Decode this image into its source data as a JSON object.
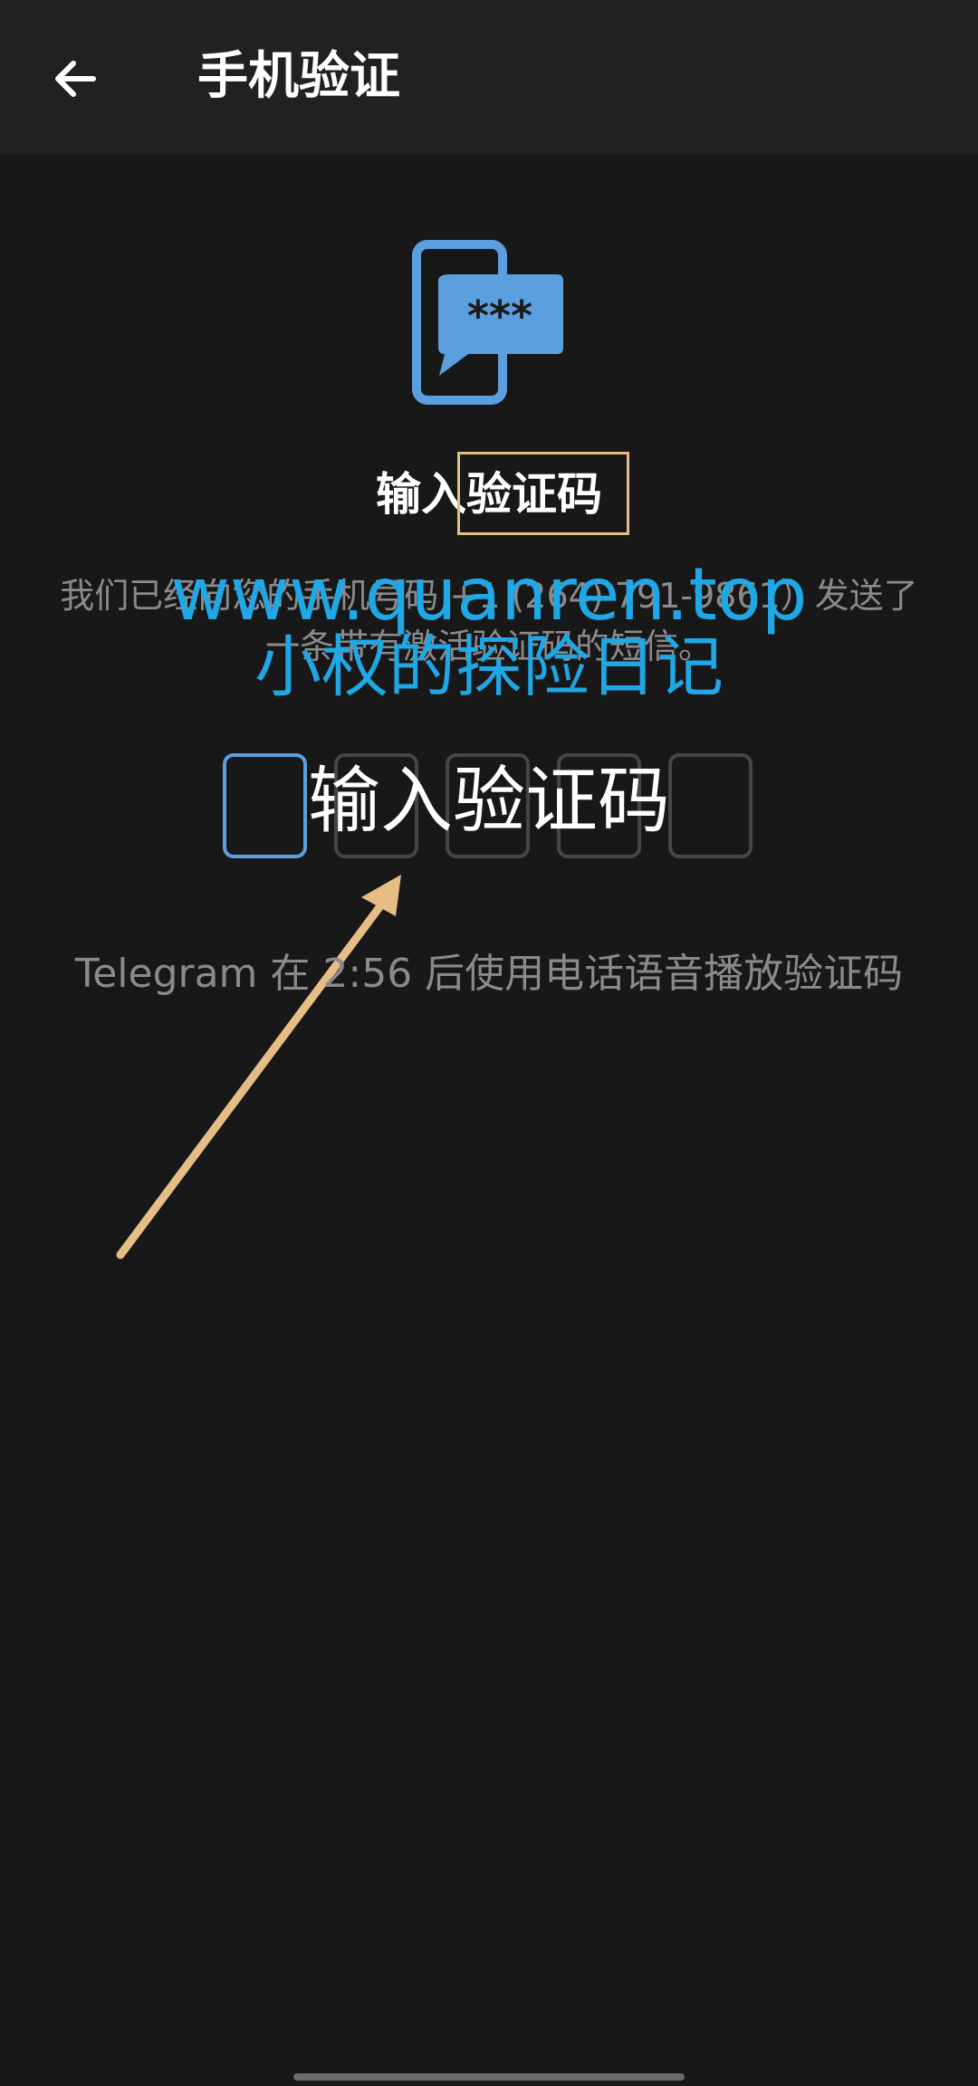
{
  "appbar": {
    "back_icon": "arrow-left-icon",
    "title": "手机验证"
  },
  "hero": {
    "icon": "sms-code-phone-icon",
    "icon_text": "***",
    "heading": "输入验证码"
  },
  "description": "我们已经向您的手机号码 +1 (264) 791-9861）发送了一条带有激活验证码的短信。",
  "watermark": {
    "url": "www.quanren.top",
    "subtitle": "小权的探险日记"
  },
  "code_input": {
    "cells": [
      "",
      "",
      "",
      "",
      ""
    ],
    "overlay_label": "输入验证码"
  },
  "voice_hint": "Telegram 在 2:56 后使用电话语音播放验证码",
  "colors": {
    "background": "#181818",
    "appbar": "#212121",
    "accent": "#5b9fdf",
    "annotation": "#e7bd86",
    "watermark": "#1fa7e6"
  }
}
